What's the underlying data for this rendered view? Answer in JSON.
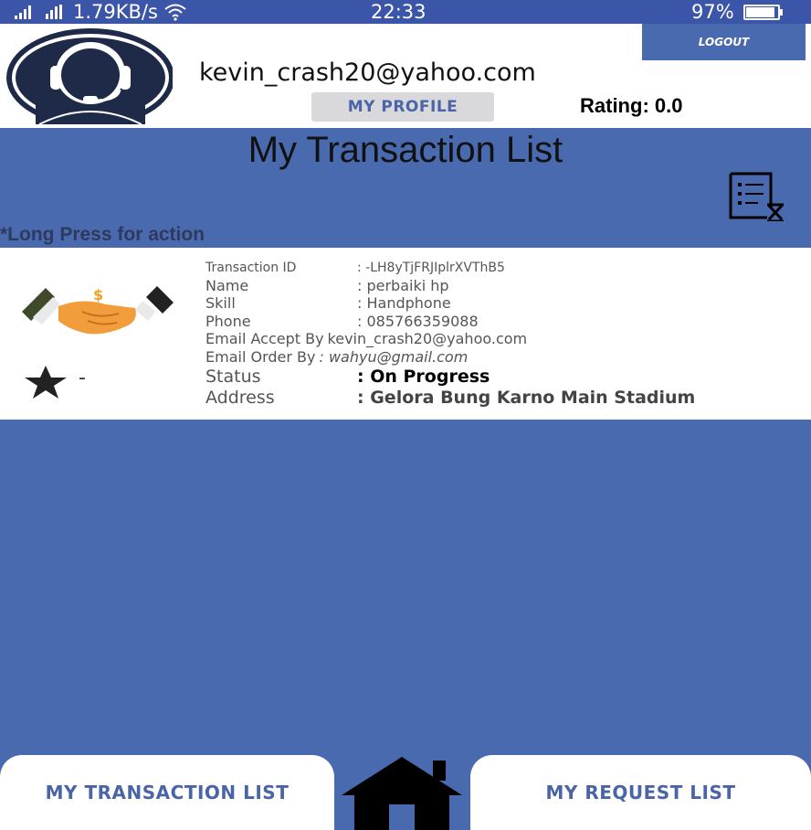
{
  "status_bar": {
    "network_speed": "1.79KB/s",
    "time": "22:33",
    "battery_percent": "97%",
    "battery_level": 0.97,
    "icons": [
      "signal-icon",
      "signal-icon",
      "wifi-icon",
      "battery-icon"
    ]
  },
  "header": {
    "email": "kevin_crash20@yahoo.com",
    "my_profile_label": "MY PROFILE",
    "rating_text": "Rating: 0.0",
    "logout_label": "LOGOUT",
    "avatar_icon": "support-agent-icon"
  },
  "page": {
    "title": "My Transaction List",
    "hint": "*Long Press for action",
    "pending_icon": "document-hourglass-icon"
  },
  "transaction": {
    "image_icon": "handshake-icon",
    "star_icon": "star-icon",
    "star_value": "-",
    "fields": {
      "transaction_id": {
        "label": "Transaction ID",
        "value": ": -LH8yTjFRJIplrXVThB5"
      },
      "name": {
        "label": "Name",
        "value": ": perbaiki hp"
      },
      "skill": {
        "label": "Skill",
        "value": ": Handphone"
      },
      "phone": {
        "label": "Phone",
        "value": ": 085766359088"
      },
      "email_accept": {
        "label": "Email Accept By",
        "value": "kevin_crash20@yahoo.com"
      },
      "email_order": {
        "label": "Email Order By",
        "value": ": wahyu@gmail.com"
      },
      "status": {
        "label": "Status",
        "value": ": On Progress"
      },
      "address": {
        "label": "Address",
        "value": ": Gelora Bung Karno Main Stadium"
      }
    }
  },
  "bottom_nav": {
    "transaction_list_label": "MY TRANSACTION LIST",
    "request_list_label": "MY REQUEST LIST",
    "home_icon": "home-icon"
  },
  "colors": {
    "accent": "#4a6aaf",
    "status_bar": "#3b55a8",
    "button_text": "#4a64a8"
  }
}
